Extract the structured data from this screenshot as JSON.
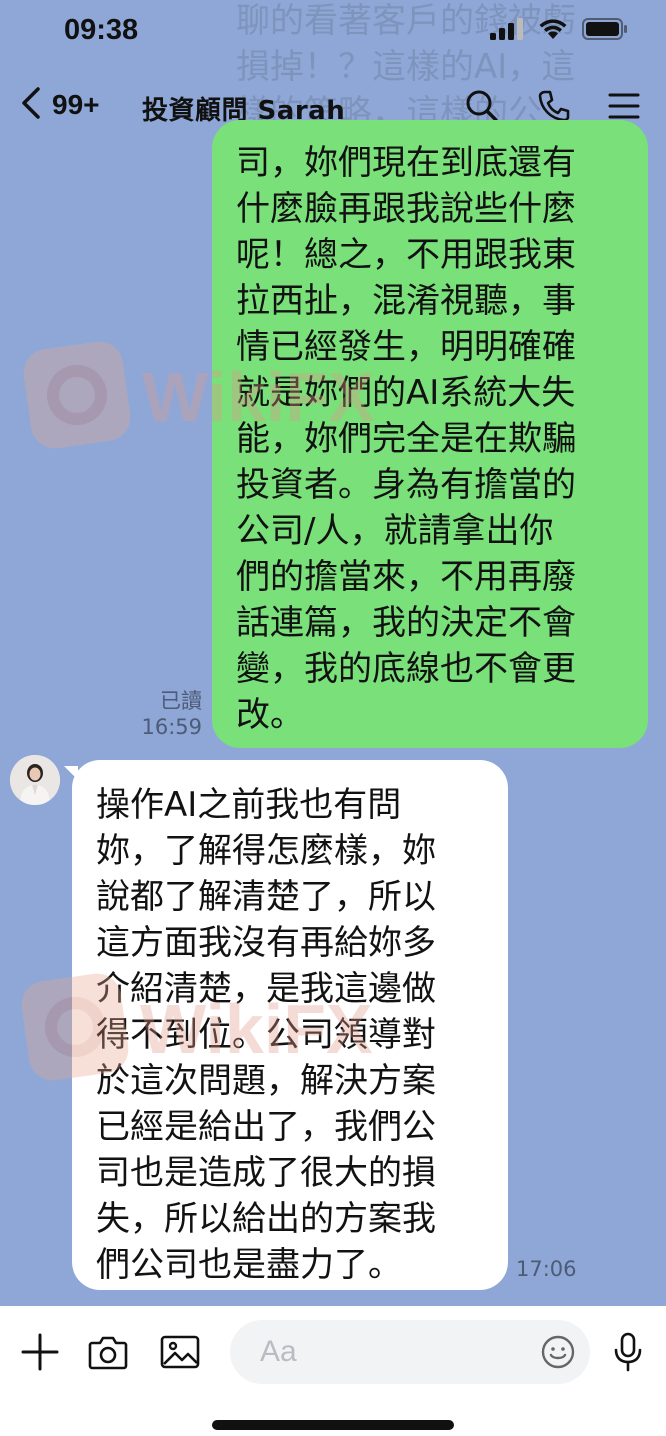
{
  "status_bar": {
    "time": "09:38"
  },
  "header": {
    "back_count": "99+",
    "title": "投資顧問 Sarah",
    "icons": [
      "search-icon",
      "phone-icon",
      "menu-icon"
    ]
  },
  "top_ghost_text": "聊的看著客戶的錢被虧\n損掉！？這樣的AI，這\n樣的策略，這樣的公",
  "messages": {
    "sent": {
      "text": "司，妳們現在到底還有\n什麼臉再跟我說些什麼\n呢！總之，不用跟我東\n拉西扯，混淆視聽，事\n情已經發生，明明確確\n就是妳們的AI系統大失\n能，妳們完全是在欺騙\n投資者。身為有擔當的\n公司/人，就請拿出你\n們的擔當來，不用再廢\n話連篇，我的決定不會\n變，我的底線也不會更\n改。",
      "read_label": "已讀",
      "time": "16:59"
    },
    "received": {
      "text": "操作AI之前我也有問\n妳，了解得怎麼樣，妳\n說都了解清楚了，所以\n這方面我沒有再給妳多\n介紹清楚，是我這邊做\n得不到位。公司領導對\n於這次問題，解決方案\n已經是給出了，我們公\n司也是造成了很大的損\n失，所以給出的方案我\n們公司也是盡力了。",
      "time": "17:06"
    }
  },
  "watermark": {
    "text": "WikiFX"
  },
  "input_bar": {
    "placeholder": "Aa",
    "value": "",
    "icons": [
      "plus-icon",
      "camera-icon",
      "image-icon",
      "emoji-icon",
      "microphone-icon"
    ]
  },
  "colors": {
    "chat_background": "#8ea7d6",
    "sent_bubble": "#79e07a",
    "received_bubble": "#ffffff"
  }
}
